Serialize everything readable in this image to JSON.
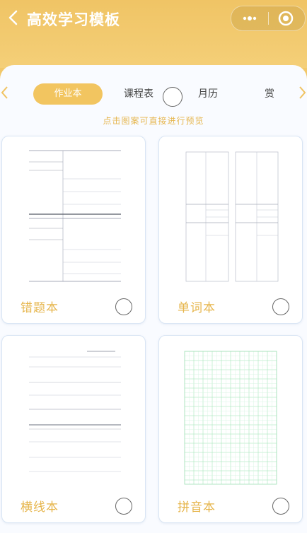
{
  "header": {
    "title": "高效学习模板",
    "back_icon": "chevron-left-icon",
    "more_icon": "more-dots-icon",
    "close_icon": "target-circle-icon"
  },
  "tabs": [
    {
      "label": "作业本",
      "active": true
    },
    {
      "label": "课程表",
      "active": false
    },
    {
      "label": "月历",
      "active": false
    },
    {
      "label": "赏",
      "active": false
    }
  ],
  "hint": "点击图案可直接进行预览",
  "templates": [
    {
      "label": "错题本",
      "thumbnail": "mistakes-notebook"
    },
    {
      "label": "单词本",
      "thumbnail": "vocabulary-notebook"
    },
    {
      "label": "横线本",
      "thumbnail": "lined-notebook"
    },
    {
      "label": "拼音本",
      "thumbnail": "pinyin-grid-notebook"
    }
  ],
  "colors": {
    "accent": "#f2c560",
    "label": "#e6b54b",
    "grid_green": "#9fe0b5"
  }
}
